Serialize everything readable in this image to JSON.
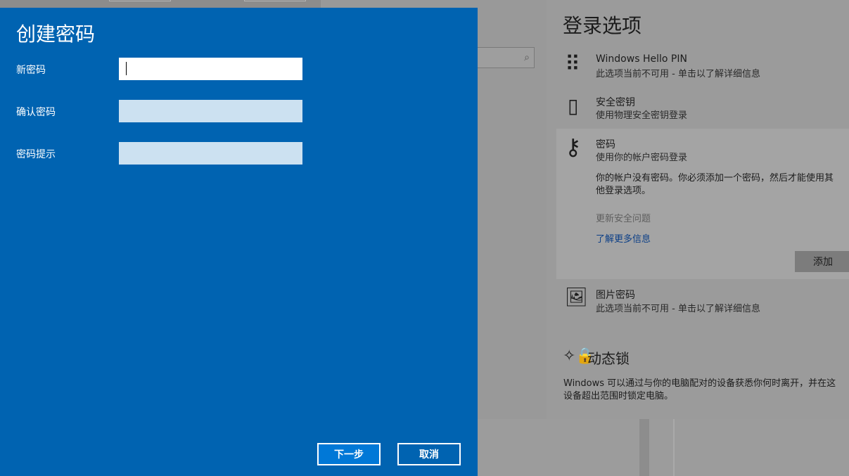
{
  "settings": {
    "title": "登录选项",
    "options": [
      {
        "icon": "keypad-icon",
        "glyph": "⠿",
        "title": "Windows Hello PIN",
        "desc": "此选项当前不可用 - 单击以了解详细信息"
      },
      {
        "icon": "usb-key-icon",
        "glyph": "▯",
        "title": "安全密钥",
        "desc": "使用物理安全密钥登录"
      },
      {
        "icon": "key-icon",
        "glyph": "⚷",
        "title": "密码",
        "desc": "使用你的帐户密码登录"
      },
      {
        "icon": "picture-icon",
        "glyph": "🖼",
        "title": "图片密码",
        "desc": "此选项当前不可用 - 单击以了解详细信息"
      }
    ],
    "password_note_line1": "你的帐户没有密码。你必须添加一个密码，然后才能使用其",
    "password_note_line2": "他登录选项。",
    "security_question": "更新安全问题",
    "learn_more": "了解更多信息",
    "add_label": "添加",
    "dynamic_lock_title": "动态锁",
    "dynamic_lock_desc_line1": "Windows 可以通过与你的电脑配对的设备获悉你何时离开，并在这",
    "dynamic_lock_desc_line2": "设备超出范围时锁定电脑。"
  },
  "dialog": {
    "title": "创建密码",
    "new_password_label": "新密码",
    "new_password_value": "",
    "confirm_password_label": "确认密码",
    "confirm_password_value": "",
    "hint_label": "密码提示",
    "hint_value": "",
    "next_label": "下一步",
    "cancel_label": "取消"
  },
  "colors": {
    "dialog_bg": "#0063b1",
    "primary_button": "#0078d7",
    "link": "#0c3f87"
  }
}
